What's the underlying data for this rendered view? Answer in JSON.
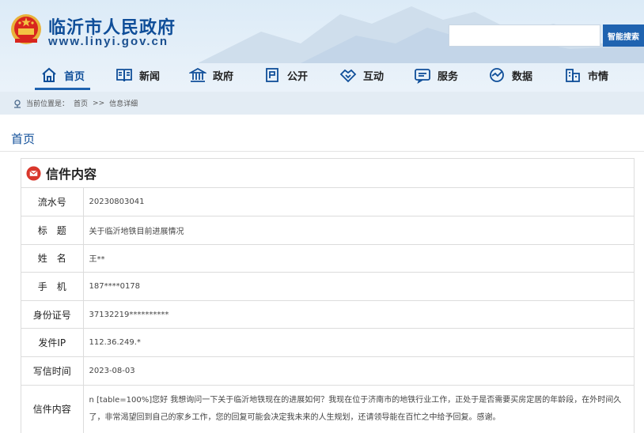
{
  "header": {
    "title": "临沂市人民政府",
    "url": "www.linyi.gov.cn",
    "search": {
      "placeholder": "",
      "button_label": "智能搜索"
    }
  },
  "nav": {
    "items": [
      {
        "label": "首页",
        "icon": "home-icon",
        "active": true
      },
      {
        "label": "新闻",
        "icon": "newspaper-icon"
      },
      {
        "label": "政府",
        "icon": "government-building-icon"
      },
      {
        "label": "公开",
        "icon": "disclosure-icon"
      },
      {
        "label": "互动",
        "icon": "handshake-icon"
      },
      {
        "label": "服务",
        "icon": "service-icon"
      },
      {
        "label": "数据",
        "icon": "data-icon"
      },
      {
        "label": "市情",
        "icon": "city-icon"
      }
    ]
  },
  "breadcrumb": {
    "prefix": "当前位置是：",
    "home": "首页",
    "separator": ">>",
    "current": "信息详细"
  },
  "page": {
    "heading": "首页"
  },
  "letter": {
    "title": "信件内容",
    "rows": [
      {
        "label": "流水号",
        "value": "20230803041"
      },
      {
        "label": "标　题",
        "value": "关于临沂地铁目前进展情况"
      },
      {
        "label": "姓　名",
        "value": "王**"
      },
      {
        "label": "手　机",
        "value": "187****0178"
      },
      {
        "label": "身份证号",
        "value": "37132219**********"
      },
      {
        "label": "发件IP",
        "value": "112.36.249.*"
      },
      {
        "label": "写信时间",
        "value": "2023-08-03"
      }
    ],
    "content": {
      "label": "信件内容",
      "value": "n [table=100%]您好 我想询问一下关于临沂地铁现在的进展如何？我现在位于济南市的地铁行业工作，正处于是否需要买房定居的年龄段，在外时间久了，非常渴望回到自己的家乡工作，您的回复可能会决定我未来的人生规划，还请领导能在百忙之中给予回复。感谢。"
    }
  },
  "colors": {
    "brand_blue": "#0f4e99",
    "search_button": "#1f63b0",
    "breadcrumb_bg": "#e3ecf4"
  }
}
